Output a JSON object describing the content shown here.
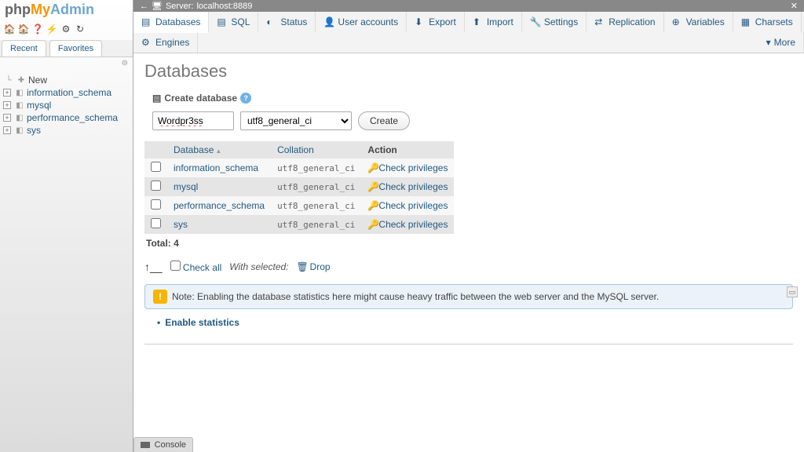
{
  "logo": {
    "php": "php",
    "my": "My",
    "admin": "Admin"
  },
  "sidebar_icons": [
    "🏠",
    "🏠",
    "❓",
    "⚡",
    "⚙",
    "↻"
  ],
  "sidebar_tabs": {
    "recent": "Recent",
    "favorites": "Favorites"
  },
  "tree": {
    "new": "New",
    "items": [
      "information_schema",
      "mysql",
      "performance_schema",
      "sys"
    ]
  },
  "breadcrumb": {
    "server_label": "Server:",
    "server_value": "localhost:8889"
  },
  "tabs": [
    {
      "label": "Databases"
    },
    {
      "label": "SQL"
    },
    {
      "label": "Status"
    },
    {
      "label": "User accounts"
    },
    {
      "label": "Export"
    },
    {
      "label": "Import"
    },
    {
      "label": "Settings"
    },
    {
      "label": "Replication"
    },
    {
      "label": "Variables"
    },
    {
      "label": "Charsets"
    },
    {
      "label": "Engines"
    },
    {
      "label": "More"
    }
  ],
  "page_title": "Databases",
  "create": {
    "label": "Create database",
    "name_value": "Wordpr3ss",
    "collation_value": "utf8_general_ci",
    "button": "Create"
  },
  "table": {
    "headers": {
      "db": "Database",
      "coll": "Collation",
      "action": "Action"
    },
    "rows": [
      {
        "name": "information_schema",
        "coll": "utf8_general_ci",
        "priv": "Check privileges"
      },
      {
        "name": "mysql",
        "coll": "utf8_general_ci",
        "priv": "Check privileges"
      },
      {
        "name": "performance_schema",
        "coll": "utf8_general_ci",
        "priv": "Check privileges"
      },
      {
        "name": "sys",
        "coll": "utf8_general_ci",
        "priv": "Check privileges"
      }
    ],
    "total_label": "Total:",
    "total_count": "4"
  },
  "bulk": {
    "check_all": "Check all",
    "with_selected": "With selected:",
    "drop": "Drop"
  },
  "note": {
    "prefix": "Note:",
    "text": "Enabling the database statistics here might cause heavy traffic between the web server and the MySQL server."
  },
  "enable_stats": "Enable statistics",
  "console": "Console"
}
